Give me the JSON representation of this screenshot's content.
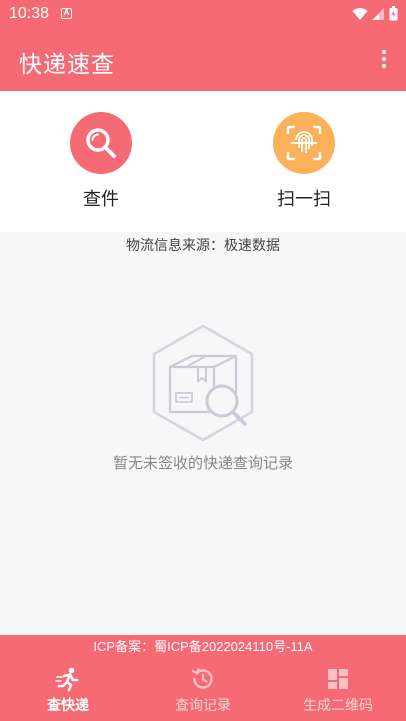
{
  "statusbar": {
    "time": "10:38",
    "notification_letter": "A"
  },
  "appbar": {
    "title": "快递速查",
    "menu_icon": "more-vert-icon"
  },
  "actions": [
    {
      "label": "查件",
      "icon": "search-icon",
      "color": "#f56a74"
    },
    {
      "label": "扫一扫",
      "icon": "fingerprint-scan-icon",
      "color": "#fbb05a"
    }
  ],
  "source_text": "物流信息来源：极速数据",
  "empty": {
    "icon": "empty-package-search-icon",
    "text": "暂无未签收的快递查询记录"
  },
  "icp_text": "ICP备案：蜀ICP备2022024110号-11A",
  "tabs": [
    {
      "label": "查快递",
      "icon": "runner-icon",
      "active": true
    },
    {
      "label": "查询记录",
      "icon": "history-icon",
      "active": false
    },
    {
      "label": "生成二维码",
      "icon": "grid-icon",
      "active": false
    }
  ],
  "colors": {
    "primary": "#f56a74",
    "accent": "#fbb05a",
    "background": "#f7f7f7"
  }
}
